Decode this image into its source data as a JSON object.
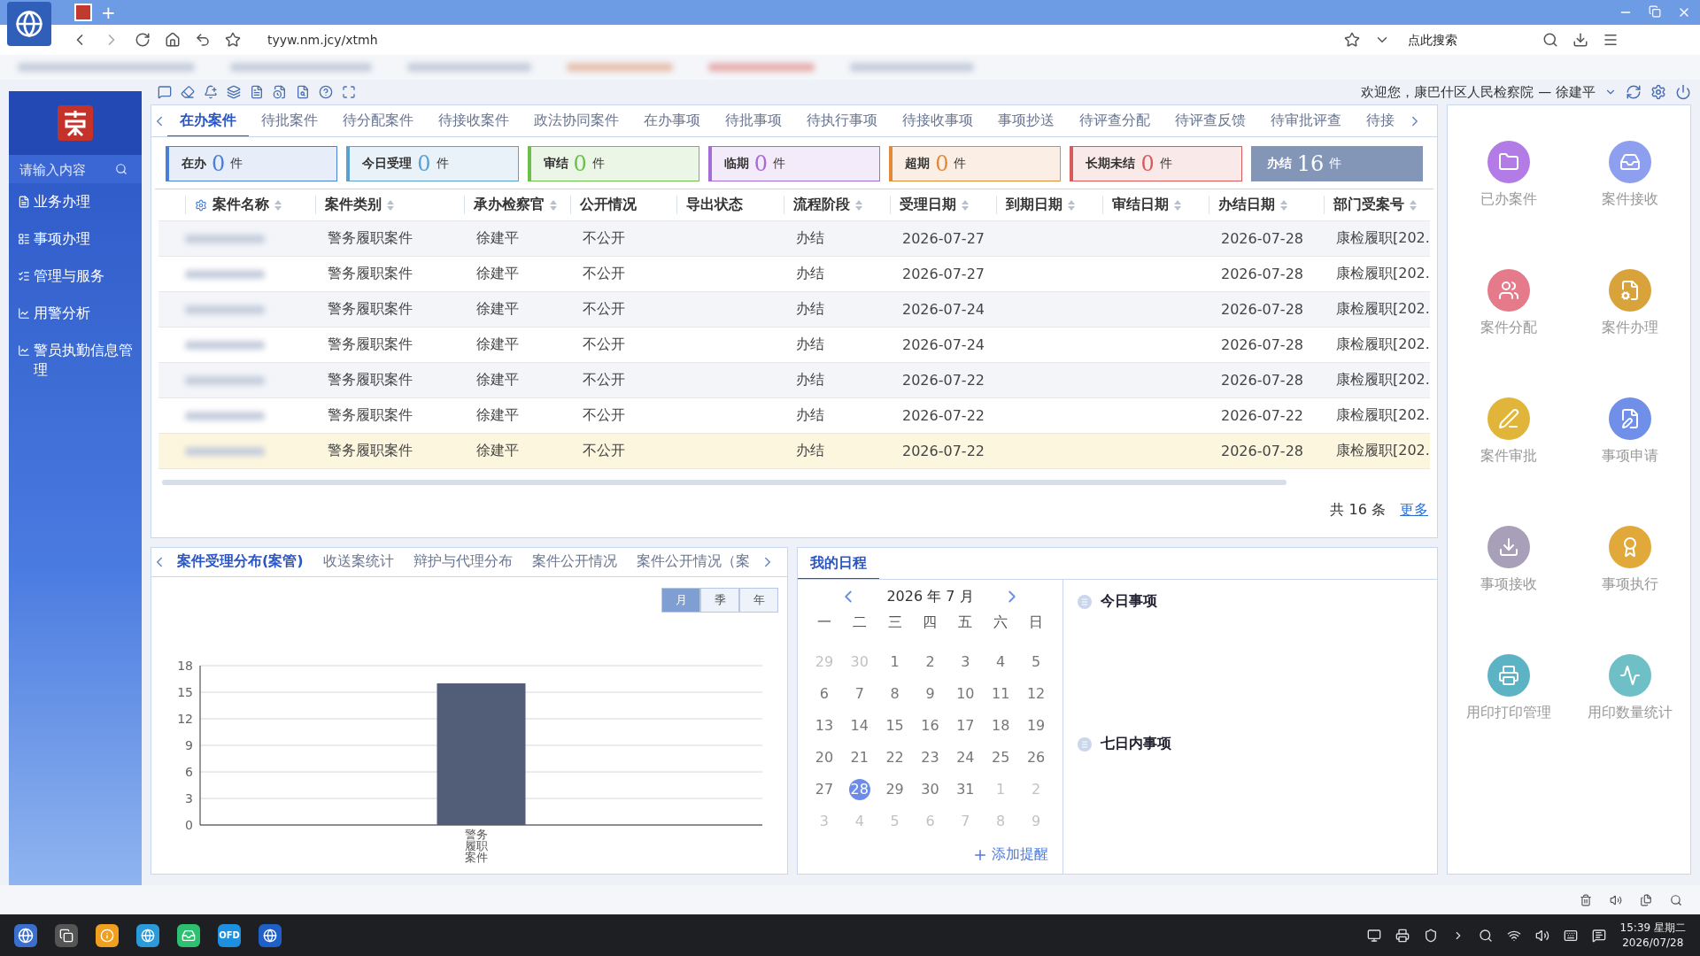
{
  "browser": {
    "address": "tyyw.nm.jcy/xtmh",
    "search_placeholder": "点此搜索",
    "new_tab": "+"
  },
  "header": {
    "welcome": "欢迎您，康巴什区人民检察院 — 徐建平"
  },
  "sidebar": {
    "search_placeholder": "请输入内容",
    "items": [
      {
        "label": "业务办理"
      },
      {
        "label": "事项办理"
      },
      {
        "label": "管理与服务"
      },
      {
        "label": "用警分析"
      },
      {
        "label": "警员执勤信息管理"
      }
    ]
  },
  "tabs": [
    {
      "label": "在办案件",
      "selected": true
    },
    {
      "label": "待批案件",
      "selected": false
    },
    {
      "label": "待分配案件",
      "selected": false
    },
    {
      "label": "待接收案件",
      "selected": false
    },
    {
      "label": "政法协同案件",
      "selected": false
    },
    {
      "label": "在办事项",
      "selected": false
    },
    {
      "label": "待批事项",
      "selected": false
    },
    {
      "label": "待执行事项",
      "selected": false
    },
    {
      "label": "待接收事项",
      "selected": false
    },
    {
      "label": "事项抄送",
      "selected": false
    },
    {
      "label": "待评查分配",
      "selected": false
    },
    {
      "label": "待评查反馈",
      "selected": false
    },
    {
      "label": "待审批评查",
      "selected": false
    },
    {
      "label": "待接",
      "selected": false
    }
  ],
  "stats": [
    {
      "label": "在办",
      "count": "0",
      "unit": "件",
      "color": "#4a7fd6",
      "selected": false
    },
    {
      "label": "今日受理",
      "count": "0",
      "unit": "件",
      "color": "#5aa0d0",
      "selected": false
    },
    {
      "label": "审结",
      "count": "0",
      "unit": "件",
      "color": "#6bbf4a",
      "selected": false
    },
    {
      "label": "临期",
      "count": "0",
      "unit": "件",
      "color": "#a56bd6",
      "selected": false
    },
    {
      "label": "超期",
      "count": "0",
      "unit": "件",
      "color": "#e08a3a",
      "selected": false
    },
    {
      "label": "长期未结",
      "count": "0",
      "unit": "件",
      "color": "#d85a5a",
      "selected": false
    },
    {
      "label": "办结",
      "count": "16",
      "unit": "件",
      "color": "#8496b8",
      "selected": true
    }
  ],
  "table": {
    "columns": [
      {
        "label": "案件名称",
        "sortable": true
      },
      {
        "label": "案件类别",
        "sortable": true
      },
      {
        "label": "承办检察官",
        "sortable": true
      },
      {
        "label": "公开情况",
        "sortable": false
      },
      {
        "label": "导出状态",
        "sortable": false
      },
      {
        "label": "流程阶段",
        "sortable": true
      },
      {
        "label": "受理日期",
        "sortable": true
      },
      {
        "label": "到期日期",
        "sortable": true
      },
      {
        "label": "审结日期",
        "sortable": true
      },
      {
        "label": "办结日期",
        "sortable": true
      },
      {
        "label": "部门受案号",
        "sortable": true
      }
    ],
    "rows": [
      {
        "selected": false,
        "cells": [
          "",
          "警务履职案件",
          "徐建平",
          "不公开",
          "",
          "办结",
          "2026-07-27",
          "",
          "",
          "2026-07-28",
          "康检履职[202."
        ]
      },
      {
        "selected": false,
        "cells": [
          "",
          "警务履职案件",
          "徐建平",
          "不公开",
          "",
          "办结",
          "2026-07-27",
          "",
          "",
          "2026-07-28",
          "康检履职[202."
        ]
      },
      {
        "selected": false,
        "cells": [
          "",
          "警务履职案件",
          "徐建平",
          "不公开",
          "",
          "办结",
          "2026-07-24",
          "",
          "",
          "2026-07-28",
          "康检履职[202."
        ]
      },
      {
        "selected": false,
        "cells": [
          "",
          "警务履职案件",
          "徐建平",
          "不公开",
          "",
          "办结",
          "2026-07-24",
          "",
          "",
          "2026-07-28",
          "康检履职[202."
        ]
      },
      {
        "selected": false,
        "cells": [
          "",
          "警务履职案件",
          "徐建平",
          "不公开",
          "",
          "办结",
          "2026-07-22",
          "",
          "",
          "2026-07-28",
          "康检履职[202."
        ]
      },
      {
        "selected": false,
        "cells": [
          "",
          "警务履职案件",
          "徐建平",
          "不公开",
          "",
          "办结",
          "2026-07-22",
          "",
          "",
          "2026-07-22",
          "康检履职[202."
        ]
      },
      {
        "selected": true,
        "cells": [
          "",
          "警务履职案件",
          "徐建平",
          "不公开",
          "",
          "办结",
          "2026-07-22",
          "",
          "",
          "2026-07-28",
          "康检履职[202."
        ]
      }
    ],
    "total": "共 16 条",
    "more": "更多"
  },
  "stats_panel": {
    "tabs": [
      {
        "label": "案件受理分布(案管)",
        "selected": true
      },
      {
        "label": "收送案统计",
        "selected": false
      },
      {
        "label": "辩护与代理分布",
        "selected": false
      },
      {
        "label": "案件公开情况",
        "selected": false
      },
      {
        "label": "案件公开情况（案",
        "selected": false
      }
    ],
    "periods": [
      {
        "label": "月",
        "selected": true
      },
      {
        "label": "季",
        "selected": false
      },
      {
        "label": "年",
        "selected": false
      }
    ],
    "chart_data": {
      "type": "bar",
      "grid": true,
      "categories": [
        "警务履职案件"
      ],
      "values": [
        16
      ],
      "ylim": [
        0,
        18
      ],
      "yticks": [
        0,
        3,
        6,
        9,
        12,
        15,
        18
      ]
    }
  },
  "schedule": {
    "title": "我的日程",
    "month": "2026 年 7 月",
    "weekdays": [
      "一",
      "二",
      "三",
      "四",
      "五",
      "六",
      "日"
    ],
    "days": [
      {
        "day": "29",
        "other": true,
        "selected": false
      },
      {
        "day": "30",
        "other": true,
        "selected": false
      },
      {
        "day": "1",
        "other": false,
        "selected": false
      },
      {
        "day": "2",
        "other": false,
        "selected": false
      },
      {
        "day": "3",
        "other": false,
        "selected": false
      },
      {
        "day": "4",
        "other": false,
        "selected": false
      },
      {
        "day": "5",
        "other": false,
        "selected": false
      },
      {
        "day": "6",
        "other": false,
        "selected": false
      },
      {
        "day": "7",
        "other": false,
        "selected": false
      },
      {
        "day": "8",
        "other": false,
        "selected": false
      },
      {
        "day": "9",
        "other": false,
        "selected": false
      },
      {
        "day": "10",
        "other": false,
        "selected": false
      },
      {
        "day": "11",
        "other": false,
        "selected": false
      },
      {
        "day": "12",
        "other": false,
        "selected": false
      },
      {
        "day": "13",
        "other": false,
        "selected": false
      },
      {
        "day": "14",
        "other": false,
        "selected": false
      },
      {
        "day": "15",
        "other": false,
        "selected": false
      },
      {
        "day": "16",
        "other": false,
        "selected": false
      },
      {
        "day": "17",
        "other": false,
        "selected": false
      },
      {
        "day": "18",
        "other": false,
        "selected": false
      },
      {
        "day": "19",
        "other": false,
        "selected": false
      },
      {
        "day": "20",
        "other": false,
        "selected": false
      },
      {
        "day": "21",
        "other": false,
        "selected": false
      },
      {
        "day": "22",
        "other": false,
        "selected": false
      },
      {
        "day": "23",
        "other": false,
        "selected": false
      },
      {
        "day": "24",
        "other": false,
        "selected": false
      },
      {
        "day": "25",
        "other": false,
        "selected": false
      },
      {
        "day": "26",
        "other": false,
        "selected": false
      },
      {
        "day": "27",
        "other": false,
        "selected": false
      },
      {
        "day": "28",
        "other": false,
        "selected": true
      },
      {
        "day": "29",
        "other": false,
        "selected": false
      },
      {
        "day": "30",
        "other": false,
        "selected": false
      },
      {
        "day": "31",
        "other": false,
        "selected": false
      },
      {
        "day": "1",
        "other": true,
        "selected": false
      },
      {
        "day": "2",
        "other": true,
        "selected": false
      },
      {
        "day": "3",
        "other": true,
        "selected": false
      },
      {
        "day": "4",
        "other": true,
        "selected": false
      },
      {
        "day": "5",
        "other": true,
        "selected": false
      },
      {
        "day": "6",
        "other": true,
        "selected": false
      },
      {
        "day": "7",
        "other": true,
        "selected": false
      },
      {
        "day": "8",
        "other": true,
        "selected": false
      },
      {
        "day": "9",
        "other": true,
        "selected": false
      }
    ],
    "add": "添加提醒",
    "sections": [
      "今日事项",
      "七日内事项"
    ]
  },
  "shortcuts": [
    {
      "label": "已办案件",
      "color": "#b27be6"
    },
    {
      "label": "案件接收",
      "color": "#8f9ff0"
    },
    {
      "label": "案件分配",
      "color": "#e47a8a"
    },
    {
      "label": "案件办理",
      "color": "#d8a33a"
    },
    {
      "label": "案件审批",
      "color": "#e0b53a"
    },
    {
      "label": "事项申请",
      "color": "#6f8fe8"
    },
    {
      "label": "事项接收",
      "color": "#a8a0b8"
    },
    {
      "label": "事项执行",
      "color": "#e0a93a"
    },
    {
      "label": "用印打印管理",
      "color": "#5bb3c4"
    },
    {
      "label": "用印数量统计",
      "color": "#6fc0c6"
    }
  ],
  "taskbar": {
    "time": "15:39 星期二",
    "date": "2026/07/28",
    "ofd": "OFD"
  }
}
